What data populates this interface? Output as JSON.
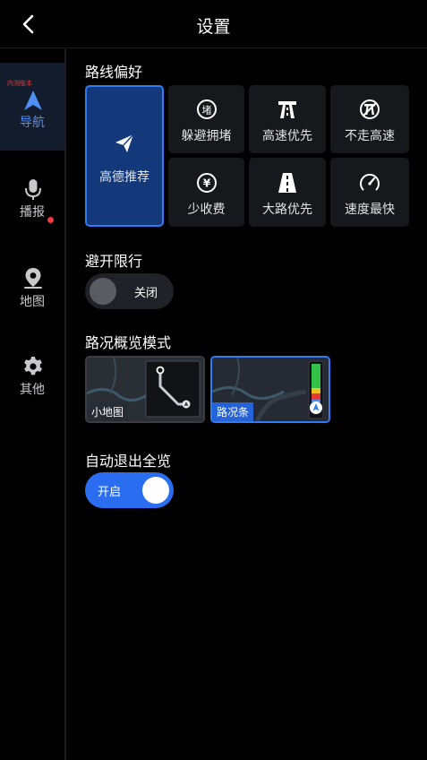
{
  "header": {
    "title": "设置"
  },
  "sidebar": {
    "beta_badge": "内测版本",
    "items": [
      {
        "label": "导航",
        "icon": "navigation-arrow-icon",
        "active": true
      },
      {
        "label": "播报",
        "icon": "microphone-icon",
        "active": false
      },
      {
        "label": "地图",
        "icon": "map-pin-icon",
        "active": false,
        "has_dot": true
      },
      {
        "label": "其他",
        "icon": "gear-icon",
        "active": false
      }
    ]
  },
  "route_preference": {
    "title": "路线偏好",
    "options": [
      {
        "label": "高德推荐",
        "icon": "paper-plane-icon",
        "selected": true
      },
      {
        "label": "躲避拥堵",
        "icon": "avoid-congestion-icon",
        "selected": false
      },
      {
        "label": "高速优先",
        "icon": "highway-icon",
        "selected": false
      },
      {
        "label": "不走高速",
        "icon": "no-highway-icon",
        "selected": false
      },
      {
        "label": "少收费",
        "icon": "yuan-toll-icon",
        "selected": false
      },
      {
        "label": "大路优先",
        "icon": "main-road-icon",
        "selected": false
      },
      {
        "label": "速度最快",
        "icon": "speedometer-icon",
        "selected": false
      }
    ]
  },
  "avoid_restriction": {
    "title": "避开限行",
    "state_label": "关闭",
    "enabled": false
  },
  "overview_mode": {
    "title": "路况概览模式",
    "options": [
      {
        "label": "小地图",
        "selected": false
      },
      {
        "label": "路况条",
        "selected": true
      }
    ]
  },
  "auto_exit_overview": {
    "title": "自动退出全览",
    "state_label": "开启",
    "enabled": true
  },
  "colors": {
    "accent": "#2f7cf6",
    "selected_tile": "#14397a",
    "tile": "#16181c",
    "active_nav": "#4d8ff5",
    "dot": "#f23b3b"
  }
}
